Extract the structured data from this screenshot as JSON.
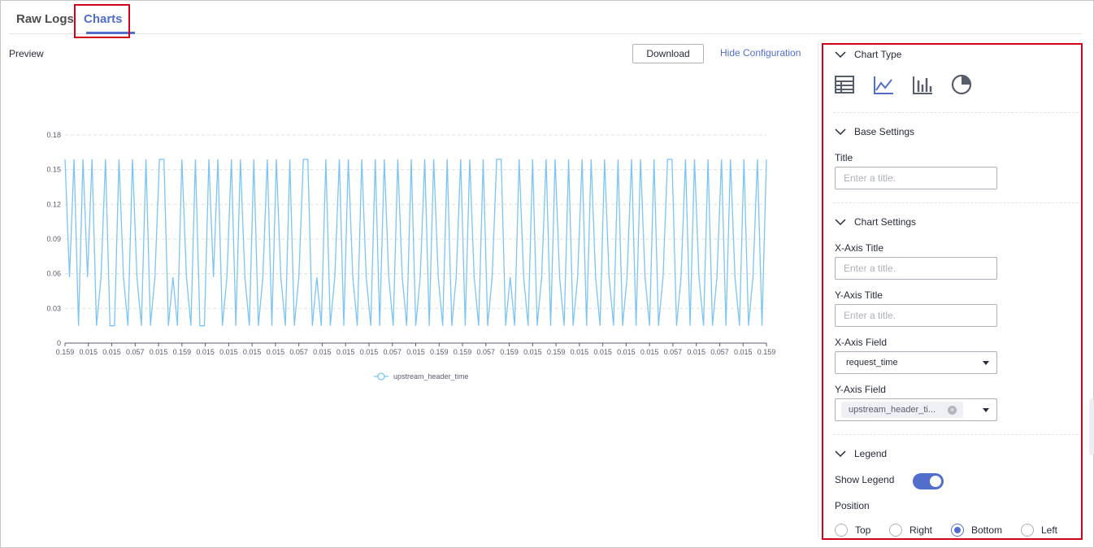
{
  "tabs": [
    {
      "label": "Raw Logs",
      "active": false
    },
    {
      "label": "Charts",
      "active": true
    }
  ],
  "preview": {
    "label": "Preview",
    "download_label": "Download",
    "hide_config_label": "Hide Configuration"
  },
  "colors": {
    "accent": "#526ecc",
    "line": "#7cc4f5",
    "highlight": "#d0021b"
  },
  "chart_data": {
    "type": "line",
    "title": "",
    "xlabel": "",
    "ylabel": "",
    "ylim": [
      0,
      0.18
    ],
    "yticks": [
      "0",
      "0.03",
      "0.06",
      "0.09",
      "0.12",
      "0.15",
      "0.18"
    ],
    "xtick_labels": [
      "0.159",
      "0.015",
      "0.015",
      "0.057",
      "0.015",
      "0.159",
      "0.015",
      "0.015",
      "0.015",
      "0.015",
      "0.057",
      "0.015",
      "0.015",
      "0.015",
      "0.057",
      "0.015",
      "0.159",
      "0.159",
      "0.057",
      "0.159",
      "0.015",
      "0.159",
      "0.015",
      "0.015",
      "0.015",
      "0.015",
      "0.057",
      "0.015",
      "0.057",
      "0.015",
      "0.159"
    ],
    "grid": true,
    "legend_position": "bottom",
    "series": [
      {
        "name": "upstream_header_time",
        "values": [
          0.159,
          0.057,
          0.159,
          0.015,
          0.159,
          0.057,
          0.159,
          0.015,
          0.057,
          0.159,
          0.015,
          0.015,
          0.159,
          0.057,
          0.015,
          0.159,
          0.057,
          0.015,
          0.159,
          0.015,
          0.057,
          0.159,
          0.159,
          0.015,
          0.057,
          0.015,
          0.159,
          0.057,
          0.015,
          0.159,
          0.015,
          0.015,
          0.159,
          0.057,
          0.159,
          0.015,
          0.057,
          0.159,
          0.015,
          0.159,
          0.057,
          0.015,
          0.159,
          0.015,
          0.057,
          0.159,
          0.015,
          0.159,
          0.057,
          0.015,
          0.159,
          0.015,
          0.057,
          0.159,
          0.159,
          0.015,
          0.057,
          0.015,
          0.159,
          0.015,
          0.057,
          0.159,
          0.015,
          0.159,
          0.057,
          0.015,
          0.159,
          0.057,
          0.015,
          0.159,
          0.015,
          0.159,
          0.057,
          0.015,
          0.159,
          0.057,
          0.015,
          0.159,
          0.015,
          0.057,
          0.159,
          0.015,
          0.159,
          0.057,
          0.015,
          0.159,
          0.015,
          0.057,
          0.159,
          0.015,
          0.159,
          0.057,
          0.015,
          0.159,
          0.015,
          0.057,
          0.159,
          0.159,
          0.015,
          0.057,
          0.015,
          0.159,
          0.057,
          0.015,
          0.159,
          0.015,
          0.057,
          0.159,
          0.015,
          0.159,
          0.057,
          0.015,
          0.159,
          0.015,
          0.057,
          0.159,
          0.015,
          0.159,
          0.057,
          0.015,
          0.159,
          0.057,
          0.015,
          0.159,
          0.015,
          0.057,
          0.159,
          0.015,
          0.159,
          0.057,
          0.015,
          0.159,
          0.015,
          0.057,
          0.159,
          0.159,
          0.015,
          0.057,
          0.159,
          0.015,
          0.159,
          0.057,
          0.015,
          0.159,
          0.015,
          0.057,
          0.159,
          0.015,
          0.159,
          0.057,
          0.015,
          0.159,
          0.015,
          0.057,
          0.159,
          0.015,
          0.159
        ]
      }
    ]
  },
  "config": {
    "chart_type": {
      "heading": "Chart Type",
      "icons": [
        {
          "name": "table-icon",
          "active": false
        },
        {
          "name": "line-chart-icon",
          "active": true
        },
        {
          "name": "bar-chart-icon",
          "active": false
        },
        {
          "name": "pie-chart-icon",
          "active": false
        }
      ]
    },
    "base_settings": {
      "heading": "Base Settings",
      "title_label": "Title",
      "title_placeholder": "Enter a title."
    },
    "chart_settings": {
      "heading": "Chart Settings",
      "x_axis_title_label": "X-Axis Title",
      "x_axis_title_placeholder": "Enter a title.",
      "y_axis_title_label": "Y-Axis Title",
      "y_axis_title_placeholder": "Enter a title.",
      "x_axis_field_label": "X-Axis Field",
      "x_axis_field_value": "request_time",
      "y_axis_field_label": "Y-Axis Field",
      "y_axis_field_value": "upstream_header_ti..."
    },
    "legend": {
      "heading": "Legend",
      "show_legend_label": "Show Legend",
      "show_legend_on": true,
      "position_label": "Position",
      "positions": [
        "Top",
        "Right",
        "Bottom",
        "Left"
      ],
      "selected_position": "Bottom"
    }
  }
}
